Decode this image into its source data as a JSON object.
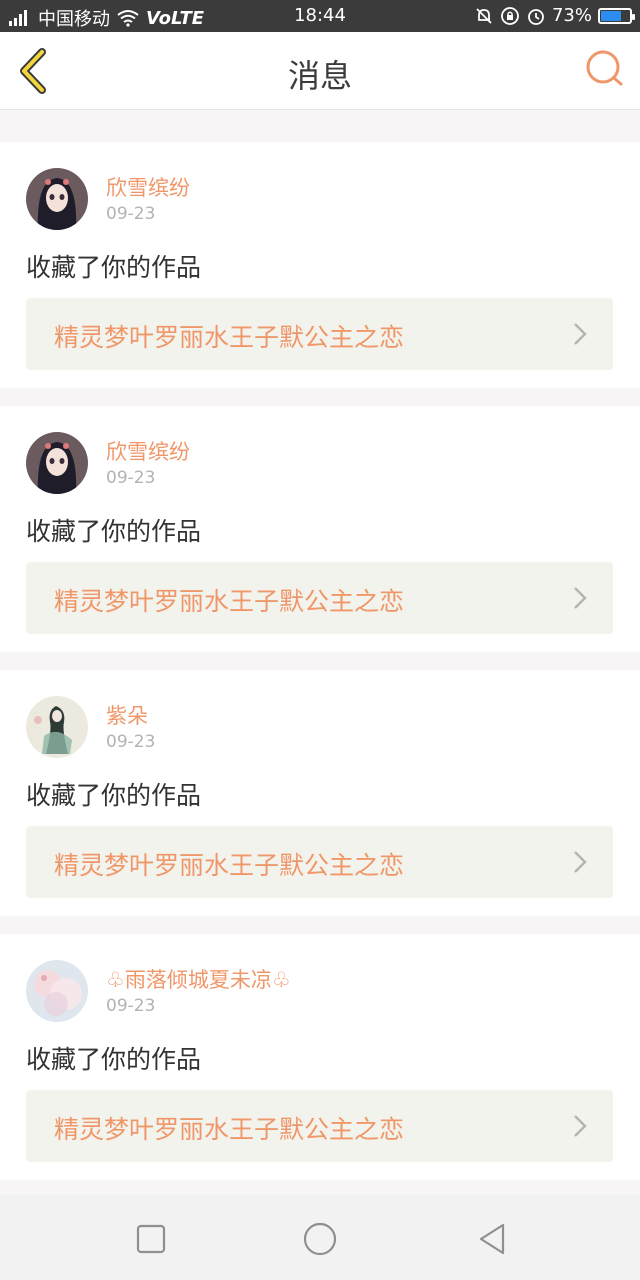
{
  "status_bar": {
    "carrier": "中国移动",
    "volte": "VoLTE",
    "time": "18:44",
    "battery": "73%",
    "battery_level": 0.73,
    "battery_color": "#2d8cf0"
  },
  "header": {
    "title": "消息",
    "back_icon": "back-chevron-icon",
    "search_icon": "search-icon",
    "accent_color": "#f0976a"
  },
  "messages": [
    {
      "name": "欣雪缤纷",
      "date": "09-23",
      "action": "收藏了你的作品",
      "work": "精灵梦叶罗丽水王子默公主之恋",
      "avatar": "doll-avatar"
    },
    {
      "name": "欣雪缤纷",
      "date": "09-23",
      "action": "收藏了你的作品",
      "work": "精灵梦叶罗丽水王子默公主之恋",
      "avatar": "doll-avatar"
    },
    {
      "name": "紫朵",
      "date": "09-23",
      "action": "收藏了你的作品",
      "work": "精灵梦叶罗丽水王子默公主之恋",
      "avatar": "ink-painting-avatar"
    },
    {
      "name": "♧雨落倾城夏未凉♧",
      "date": "09-23",
      "action": "收藏了你的作品",
      "work": "精灵梦叶罗丽水王子默公主之恋",
      "avatar": "pastel-avatar"
    }
  ],
  "nav": {
    "recent_icon": "square-icon",
    "home_icon": "circle-icon",
    "back_icon": "triangle-back-icon"
  }
}
